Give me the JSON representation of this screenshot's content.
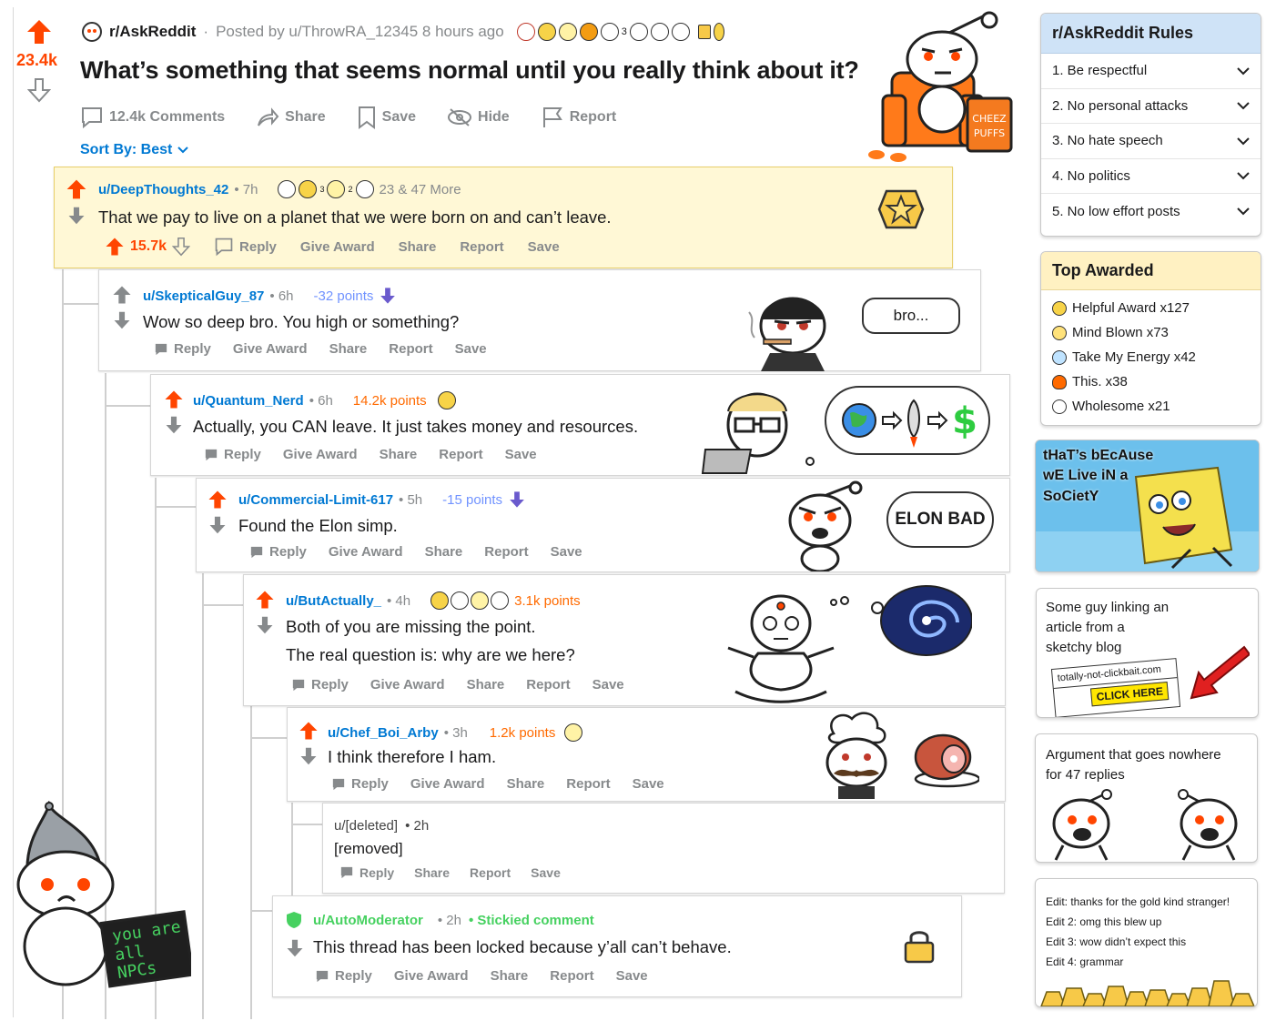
{
  "post": {
    "score": "23.4k",
    "subreddit": "r/AskReddit",
    "posted_by": "Posted by u/ThrowRA_12345 8 hours ago",
    "award_num": "3",
    "title": "What’s something that seems normal until you really think about it?",
    "comments": "12.4k Comments",
    "share": "Share",
    "save": "Save",
    "hide": "Hide",
    "report": "Report",
    "sort": "Sort By: Best",
    "chair_text": "CHEEZ PUFFS"
  },
  "actions": {
    "reply": "Reply",
    "give_award": "Give Award",
    "share": "Share",
    "report": "Report",
    "save": "Save"
  },
  "comments": [
    {
      "user": "u/DeepThoughts_42",
      "age": "• 7h",
      "awards_more": "23 & 47 More",
      "award_num_1": "3",
      "award_num_2": "2",
      "text": "That we pay to live on a planet that we were born on and can’t leave.",
      "score": "15.7k"
    },
    {
      "user": "u/SkepticalGuy_87",
      "age": "• 6h",
      "points": "-32 points",
      "text": "Wow so deep bro. You high or something?",
      "bubble": "bro..."
    },
    {
      "user": "u/Quantum_Nerd",
      "age": "• 6h",
      "points": "14.2k points",
      "text": "Actually, you CAN leave. It just takes money and resources."
    },
    {
      "user": "u/Commercial-Limit-617",
      "age": "• 5h",
      "points": "-15 points",
      "text": "Found the Elon simp.",
      "bubble": "ELON BAD"
    },
    {
      "user": "u/ButActually_",
      "age": "• 4h",
      "points": "3.1k points",
      "text": "Both of you are missing the point.",
      "text2": "The real question is: why are we here?"
    },
    {
      "user": "u/Chef_Boi_Arby",
      "age": "• 3h",
      "points": "1.2k points",
      "text": "I think therefore I ham."
    },
    {
      "user": "u/[deleted]",
      "age": "• 2h",
      "text": "[removed]"
    },
    {
      "user": "u/AutoModerator",
      "age": "• 2h",
      "sticky": "• Stickied comment",
      "text": "This thread has been locked because y’all can’t behave."
    }
  ],
  "sidebar": {
    "rules_title": "r/AskReddit Rules",
    "rules": [
      "1. Be respectful",
      "2. No personal attacks",
      "3. No hate speech",
      "4. No politics",
      "5. No low effort posts"
    ],
    "top_awarded_title": "Top Awarded",
    "top_awarded": [
      {
        "label": "Helpful Award x127",
        "icon": "helpful-award-icon"
      },
      {
        "label": "Mind Blown x73",
        "icon": "mind-blown-icon"
      },
      {
        "label": "Take My Energy x42",
        "icon": "take-my-energy-icon"
      },
      {
        "label": "This. x38",
        "icon": "fire-icon"
      },
      {
        "label": "Wholesome x21",
        "icon": "wholesome-icon"
      }
    ],
    "meme_text": "tHaT’s bEcAuse wE Live iN a SoCietY",
    "clickbait_caption": "Some guy linking an article from a sketchy blog",
    "clickbait_url": "totally-not-clickbait.com",
    "clickbait_button": "CLICK HERE",
    "argument_caption": "Argument that goes nowhere for 47 replies",
    "edits": [
      "Edit: thanks for the gold kind stranger!",
      "Edit 2: omg this blew up",
      "Edit 3: wow didn’t expect this",
      "Edit 4: grammar"
    ]
  },
  "npc": {
    "text": "you are all NPCs"
  },
  "colors": {
    "orange": "#ff4500",
    "blue": "#0079d3",
    "downvote": "#7193ff",
    "gold_bg": "#fff8d6",
    "rules_header": "#cfe3f7",
    "top_header": "#fff1c2",
    "mod_green": "#46d160"
  }
}
